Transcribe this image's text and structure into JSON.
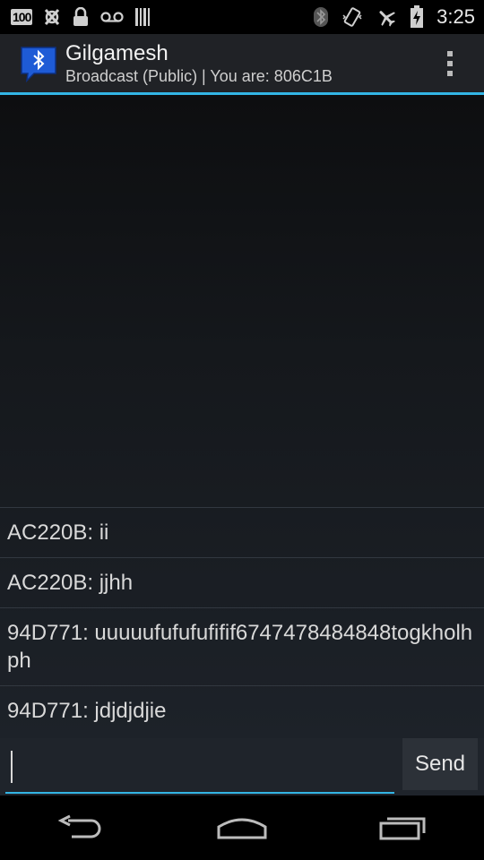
{
  "status_bar": {
    "battery_badge": "100",
    "time": "3:25",
    "left_icons": [
      "battery-100-icon",
      "usb-debug-icon",
      "lock-icon",
      "voicemail-icon",
      "barcode-icon"
    ],
    "right_icons": [
      "bluetooth-icon",
      "vibrate-icon",
      "airplane-icon",
      "battery-charging-icon"
    ]
  },
  "action_bar": {
    "title": "Gilgamesh",
    "subtitle": "Broadcast (Public) | You are: 806C1B",
    "accent_color": "#33b5e5"
  },
  "messages": [
    {
      "text": "AC220B: ii"
    },
    {
      "text": "AC220B: jjhh"
    },
    {
      "text": "94D771: uuuuufufufufifif6747478484848togkholhph"
    },
    {
      "text": "94D771: jdjdjdjie"
    }
  ],
  "composer": {
    "input_value": "",
    "send_label": "Send"
  },
  "nav_bar": {
    "buttons": [
      "back-icon",
      "home-icon",
      "recents-icon"
    ]
  }
}
